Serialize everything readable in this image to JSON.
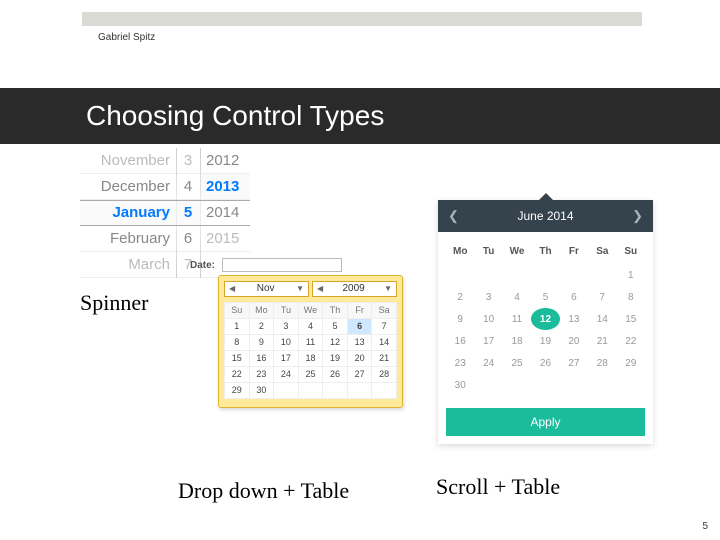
{
  "author": "Gabriel Spitz",
  "title": "Choosing Control Types",
  "page_number": "5",
  "labels": {
    "spinner": "Spinner",
    "dropdown_table": "Drop down + Table",
    "scroll_table": "Scroll + Table"
  },
  "spinner": {
    "months": [
      "November",
      "December",
      "January",
      "February",
      "March"
    ],
    "days": [
      "3",
      "4",
      "5",
      "6",
      "7"
    ],
    "years": [
      "2012",
      "2013",
      "2014",
      "2015",
      ""
    ],
    "selected_index": 2
  },
  "dropdown": {
    "field_label": "Date:",
    "month": "Nov",
    "year": "2009",
    "weekdays": [
      "Su",
      "Mo",
      "Tu",
      "We",
      "Th",
      "Fr",
      "Sa"
    ],
    "rows": [
      [
        "1",
        "2",
        "3",
        "4",
        "5",
        "6",
        "7"
      ],
      [
        "8",
        "9",
        "10",
        "11",
        "12",
        "13",
        "14"
      ],
      [
        "15",
        "16",
        "17",
        "18",
        "19",
        "20",
        "21"
      ],
      [
        "22",
        "23",
        "24",
        "25",
        "26",
        "27",
        "28"
      ],
      [
        "29",
        "30",
        "",
        "",
        "",
        "",
        ""
      ]
    ],
    "highlight": [
      0,
      5
    ]
  },
  "scroll": {
    "header": "June 2014",
    "weekdays": [
      "Mo",
      "Tu",
      "We",
      "Th",
      "Fr",
      "Sa",
      "Su"
    ],
    "rows": [
      [
        "",
        "",
        "",
        "",
        "",
        "",
        "1"
      ],
      [
        "2",
        "3",
        "4",
        "5",
        "6",
        "7",
        "8"
      ],
      [
        "9",
        "10",
        "11",
        "12",
        "13",
        "14",
        "15"
      ],
      [
        "16",
        "17",
        "18",
        "19",
        "20",
        "21",
        "22"
      ],
      [
        "23",
        "24",
        "25",
        "26",
        "27",
        "28",
        "29"
      ],
      [
        "30",
        "",
        "",
        "",
        "",
        "",
        ""
      ]
    ],
    "current": 12,
    "apply_label": "Apply"
  }
}
